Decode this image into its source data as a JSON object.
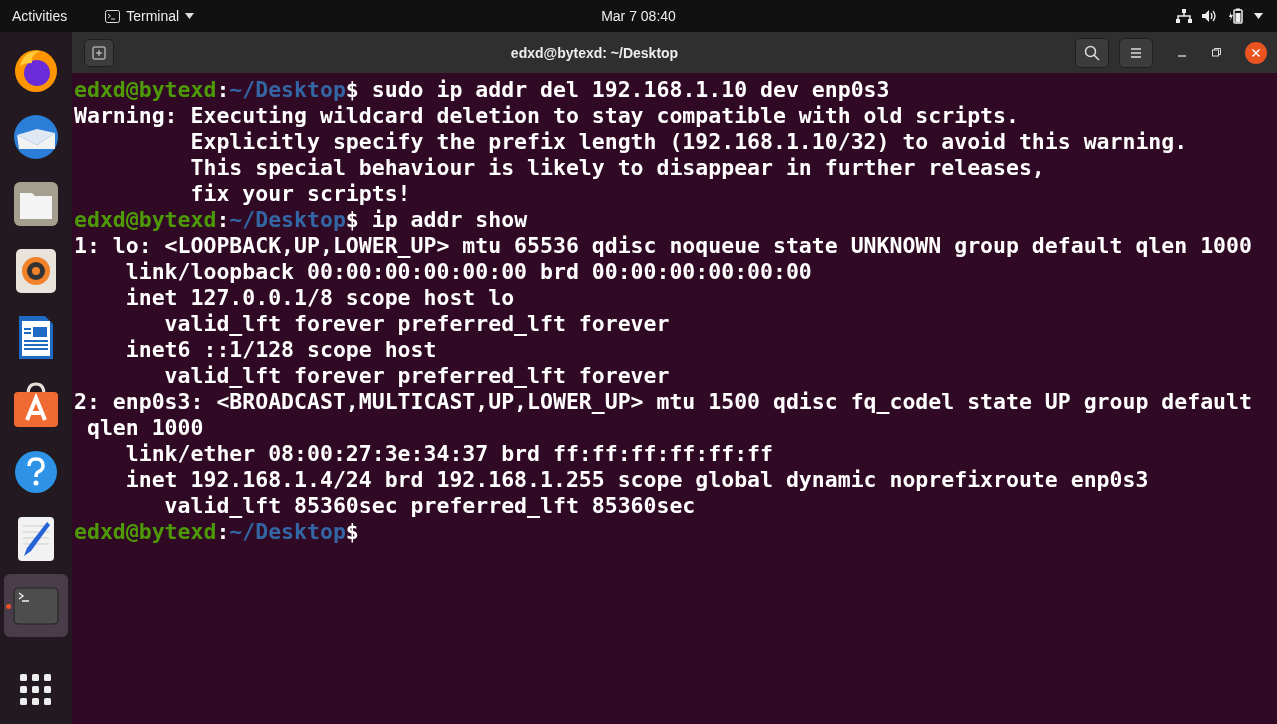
{
  "top_bar": {
    "activities": "Activities",
    "app_menu": "Terminal",
    "clock": "Mar 7  08:40"
  },
  "dock": {
    "items": [
      {
        "kind": "browser",
        "selected": false,
        "running": false
      },
      {
        "kind": "mail",
        "selected": false,
        "running": false
      },
      {
        "kind": "files",
        "selected": false,
        "running": false
      },
      {
        "kind": "music",
        "selected": false,
        "running": false
      },
      {
        "kind": "writer",
        "selected": false,
        "running": false
      },
      {
        "kind": "store",
        "selected": false,
        "running": false
      },
      {
        "kind": "help",
        "selected": false,
        "running": false
      },
      {
        "kind": "editor",
        "selected": false,
        "running": false
      },
      {
        "kind": "terminal",
        "selected": true,
        "running": true
      }
    ]
  },
  "window": {
    "title": "edxd@bytexd: ~/Desktop"
  },
  "terminal": {
    "lines": [
      {
        "kind": "prompt",
        "user": "edxd@bytexd",
        "separator": ":",
        "path": "~/Desktop",
        "symbol": "$",
        "command": " sudo ip addr del 192.168.1.10 dev enp0s3"
      },
      {
        "kind": "output",
        "text": "Warning: Executing wildcard deletion to stay compatible with old scripts."
      },
      {
        "kind": "output",
        "text": "         Explicitly specify the prefix length (192.168.1.10/32) to avoid this warning."
      },
      {
        "kind": "output",
        "text": "         This special behaviour is likely to disappear in further releases,"
      },
      {
        "kind": "output",
        "text": "         fix your scripts!"
      },
      {
        "kind": "prompt",
        "user": "edxd@bytexd",
        "separator": ":",
        "path": "~/Desktop",
        "symbol": "$",
        "command": " ip addr show"
      },
      {
        "kind": "output",
        "text": "1: lo: <LOOPBACK,UP,LOWER_UP> mtu 65536 qdisc noqueue state UNKNOWN group default qlen 1000"
      },
      {
        "kind": "output",
        "text": "    link/loopback 00:00:00:00:00:00 brd 00:00:00:00:00:00"
      },
      {
        "kind": "output",
        "text": "    inet 127.0.0.1/8 scope host lo"
      },
      {
        "kind": "output",
        "text": "       valid_lft forever preferred_lft forever"
      },
      {
        "kind": "output",
        "text": "    inet6 ::1/128 scope host"
      },
      {
        "kind": "output",
        "text": "       valid_lft forever preferred_lft forever"
      },
      {
        "kind": "output",
        "text": "2: enp0s3: <BROADCAST,MULTICAST,UP,LOWER_UP> mtu 1500 qdisc fq_codel state UP group default"
      },
      {
        "kind": "output",
        "text": " qlen 1000"
      },
      {
        "kind": "output",
        "text": "    link/ether 08:00:27:3e:34:37 brd ff:ff:ff:ff:ff:ff"
      },
      {
        "kind": "output",
        "text": "    inet 192.168.1.4/24 brd 192.168.1.255 scope global dynamic noprefixroute enp0s3"
      },
      {
        "kind": "output",
        "text": "       valid_lft 85360sec preferred_lft 85360sec"
      },
      {
        "kind": "prompt",
        "user": "edxd@bytexd",
        "separator": ":",
        "path": "~/Desktop",
        "symbol": "$"
      }
    ]
  }
}
